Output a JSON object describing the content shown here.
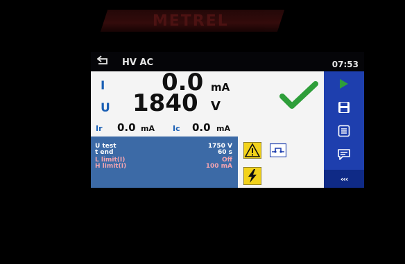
{
  "header": {
    "title": "HV AC",
    "clock": "07:53"
  },
  "results": {
    "current": {
      "label": "I",
      "value": "0.0",
      "unit": "mA"
    },
    "voltage": {
      "label": "U",
      "value": "1840",
      "unit": "V"
    },
    "ir": {
      "label": "Ir",
      "value": "0.0",
      "unit": "mA"
    },
    "ic": {
      "label": "Ic",
      "value": "0.0",
      "unit": "mA"
    },
    "status": "pass"
  },
  "parameters": [
    {
      "name": "U test",
      "value": "1750 V",
      "color": "#ffffff"
    },
    {
      "name": "t end",
      "value": "60 s",
      "color": "#ffffff"
    },
    {
      "name": "L limit(I)",
      "value": "Off",
      "color": "#f2a4b0"
    },
    {
      "name": "H limit(I)",
      "value": "100 mA",
      "color": "#f2a4b0"
    }
  ],
  "sidebar": {
    "items": [
      {
        "icon": "play-icon"
      },
      {
        "icon": "save-icon"
      },
      {
        "icon": "list-icon"
      },
      {
        "icon": "comment-icon"
      }
    ],
    "more_label": "‹‹‹"
  },
  "colors": {
    "accent_blue": "#1e3fae",
    "param_panel": "#3c6aa6",
    "pass_green": "#2e9e3a",
    "warning_yellow": "#f2d21b",
    "label_blue": "#1a5fb4"
  }
}
